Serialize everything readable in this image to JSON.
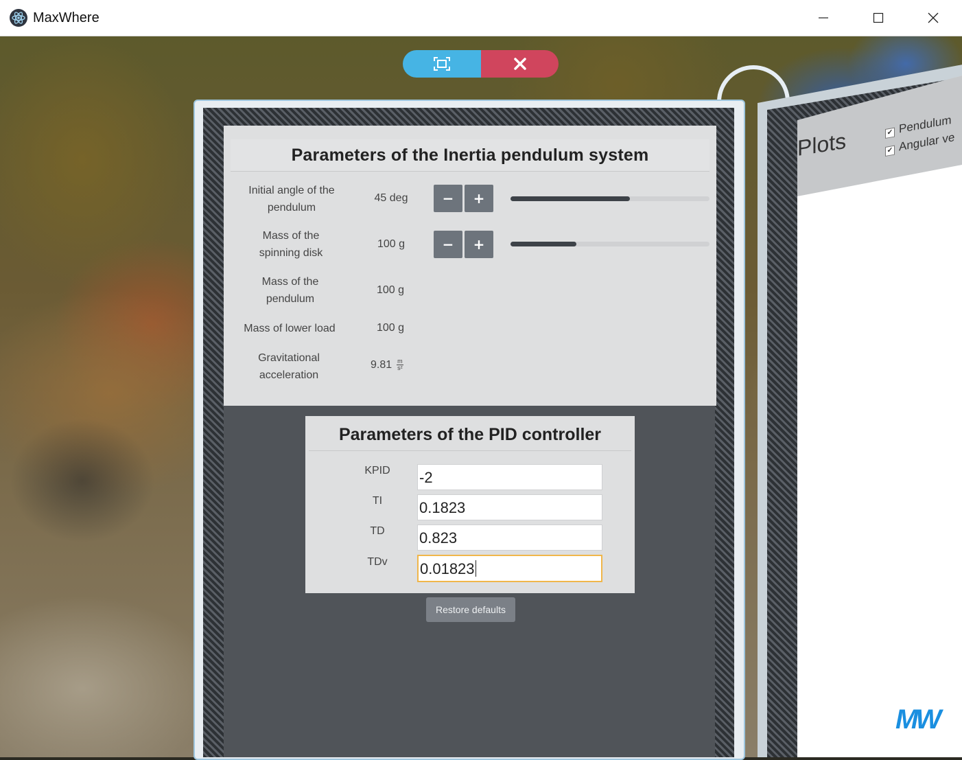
{
  "window": {
    "title": "MaxWhere",
    "minimize_glyph": "─",
    "maximize_glyph": "☐",
    "close_glyph": "✕"
  },
  "scene_controls": {
    "fit_icon": "fit-screen-icon",
    "close_icon": "close-icon",
    "colors": {
      "fit": "#46b4e4",
      "close": "#d0455d"
    }
  },
  "inertia": {
    "title": "Parameters of the Inertia pendulum system",
    "params": [
      {
        "label_line1": "Initial angle of the",
        "label_line2": "pendulum",
        "value": "45 deg",
        "minus": "−",
        "plus": "+",
        "level": 0.6
      },
      {
        "label_line1": "Mass of the",
        "label_line2": "spinning disk",
        "value": "100 g",
        "minus": "−",
        "plus": "+",
        "level": 0.33
      },
      {
        "label_line1": "Mass of the",
        "label_line2": "pendulum",
        "value": "100 g"
      },
      {
        "label_line1": "Mass of lower load",
        "value": "100 g"
      },
      {
        "label_line1": "Gravitational",
        "label_line2": "acceleration",
        "value": "9.81",
        "unit_num": "m",
        "unit_den": "s²"
      }
    ]
  },
  "pid": {
    "title": "Parameters of the PID controller",
    "fields": [
      {
        "label": "KPID",
        "value": "-2"
      },
      {
        "label": "TI",
        "value": "0.1823"
      },
      {
        "label": "TD",
        "value": "0.823"
      },
      {
        "label": "TDv",
        "value": "0.01823"
      }
    ],
    "restore_label": "Restore defaults"
  },
  "plots": {
    "title": "Plots",
    "checks": [
      {
        "label": "Pendulum",
        "checked": true
      },
      {
        "label": "Angular ve",
        "checked": true
      }
    ]
  },
  "logo": {
    "text": "MW",
    "color": "#1a8fe0"
  }
}
